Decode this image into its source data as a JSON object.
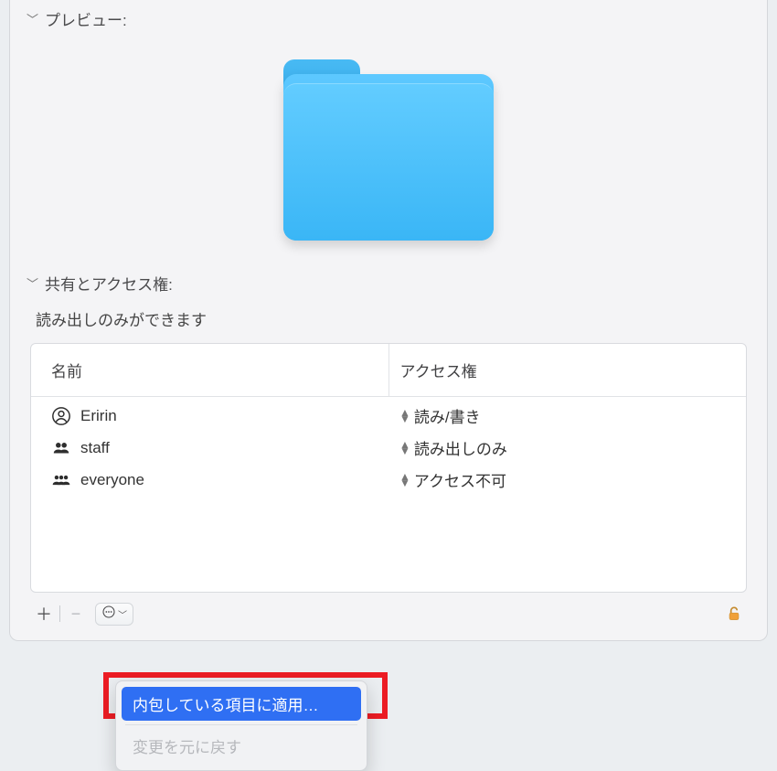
{
  "preview": {
    "title": "プレビュー:"
  },
  "sharing": {
    "title": "共有とアクセス権:",
    "summary": "読み出しのみができます",
    "columns": {
      "name": "名前",
      "privilege": "アクセス権"
    },
    "entries": [
      {
        "icon": "user",
        "name": "Eririn",
        "privilege": "読み/書き"
      },
      {
        "icon": "group",
        "name": "staff",
        "privilege": "読み出しのみ"
      },
      {
        "icon": "group",
        "name": "everyone",
        "privilege": "アクセス不可"
      }
    ]
  },
  "popup": {
    "apply_enclosed": "内包している項目に適用…",
    "revert_changes": "変更を元に戻す"
  },
  "glyphs": {
    "plus": "＋",
    "minus": "−",
    "chev_down": "﹀"
  }
}
